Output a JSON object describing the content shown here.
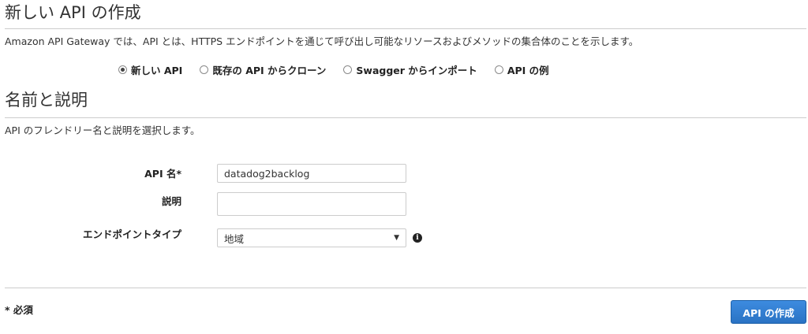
{
  "header": {
    "title": "新しい API の作成",
    "description": "Amazon API Gateway では、API とは、HTTPS エンドポイントを通じて呼び出し可能なリソースおよびメソッドの集合体のことを示します。"
  },
  "creation_options": {
    "selected": "新しい API",
    "options": [
      {
        "label": "新しい API",
        "checked": true
      },
      {
        "label": "既存の API からクローン",
        "checked": false
      },
      {
        "label": "Swagger からインポート",
        "checked": false
      },
      {
        "label": "API の例",
        "checked": false
      }
    ]
  },
  "name_section": {
    "title": "名前と説明",
    "description": "API のフレンドリー名と説明を選択します。"
  },
  "form": {
    "api_name_label": "API 名*",
    "api_name_value": "datadog2backlog",
    "description_label": "説明",
    "description_value": "",
    "endpoint_type_label": "エンドポイントタイプ",
    "endpoint_type_value": "地域",
    "select_arrow": "▼",
    "info_glyph": "i"
  },
  "footer": {
    "required_note": "* 必須",
    "create_button_label": "API の作成"
  },
  "icons": {
    "endpoint_info": "info-icon",
    "select_arrow": "chevron-down-icon"
  },
  "colors": {
    "primary_button": "#2a73c4",
    "rule": "#cccccc",
    "text": "#222222"
  }
}
